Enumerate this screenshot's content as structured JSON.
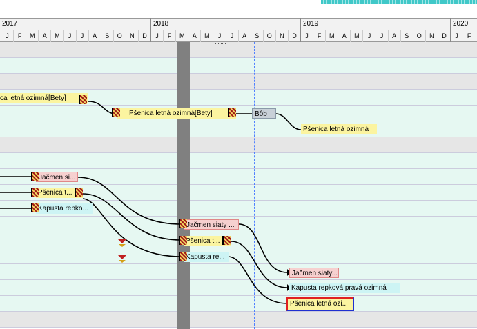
{
  "timeline": {
    "years": [
      "2017",
      "2018",
      "2019",
      "2020"
    ],
    "month_letters": [
      "J",
      "F",
      "M",
      "A",
      "M",
      "J",
      "J",
      "A",
      "S",
      "O",
      "N",
      "D"
    ],
    "last_year_months": [
      "J",
      "F"
    ]
  },
  "bars": {
    "b1": "ca letná ozimná[Bety]",
    "b2": "Pšenica letná ozimná[Bety]",
    "b3": "Bôb",
    "b4": "Pšenica letná ozimná",
    "b5": "Jačmen si...",
    "b6": "Pšenica t...",
    "b7": "Kapusta repko...",
    "b8": "Jačmen siaty ...",
    "b9": "Pšenica t...",
    "b10": "Kapusta re...",
    "b11": "Jačmen siaty...",
    "b12": "Kapusta repková pravá ozimná",
    "b13": "Pšenica letná ozi..."
  },
  "colors": {
    "row_alt": "#e6e6e6",
    "row_main": "#e6f8f2",
    "today_line": "#5080ff",
    "current_band": "#808080"
  }
}
